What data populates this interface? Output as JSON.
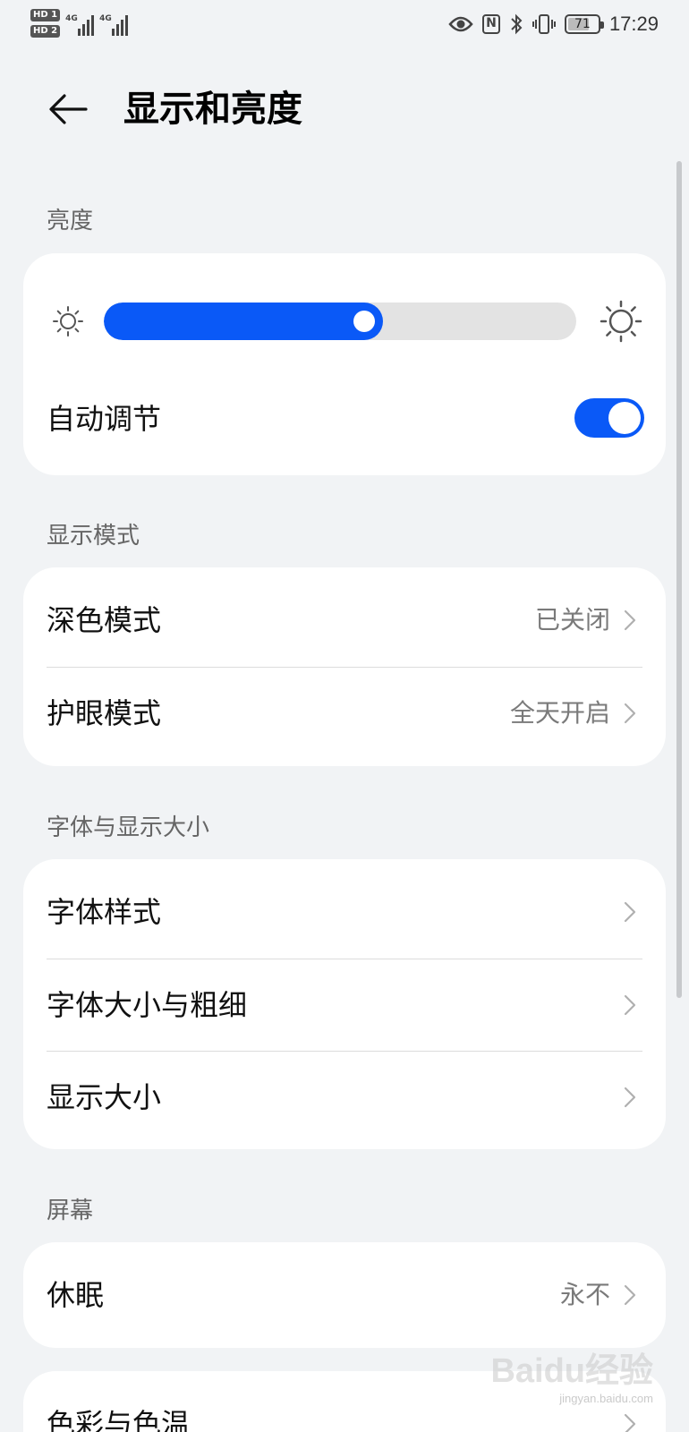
{
  "status_bar": {
    "sim1": "HD 1",
    "sim2": "HD 2",
    "net1": "4G",
    "net2": "4G",
    "battery_level": "71",
    "battery_fraction": 0.71,
    "time": "17:29",
    "icons": [
      "eye-icon",
      "nfc-icon",
      "bluetooth-icon",
      "vibrate-icon",
      "battery-icon"
    ]
  },
  "header": {
    "back_icon": "arrow-left-icon",
    "title": "显示和亮度"
  },
  "brightness": {
    "section_title": "亮度",
    "slider_level": 0.59,
    "auto_label": "自动调节",
    "auto_enabled": true,
    "accent_color": "#0a59f7"
  },
  "display_mode": {
    "section_title": "显示模式",
    "items": [
      {
        "label": "深色模式",
        "value": "已关闭"
      },
      {
        "label": "护眼模式",
        "value": "全天开启"
      }
    ]
  },
  "font_size": {
    "section_title": "字体与显示大小",
    "items": [
      {
        "label": "字体样式"
      },
      {
        "label": "字体大小与粗细"
      },
      {
        "label": "显示大小"
      }
    ]
  },
  "screen": {
    "section_title": "屏幕",
    "items": [
      {
        "label": "休眠",
        "value": "永不"
      }
    ]
  },
  "color": {
    "items": [
      {
        "label": "色彩与色温"
      }
    ]
  },
  "watermark": {
    "text": "Baidu经验",
    "sub": "jingyan.baidu.com"
  }
}
